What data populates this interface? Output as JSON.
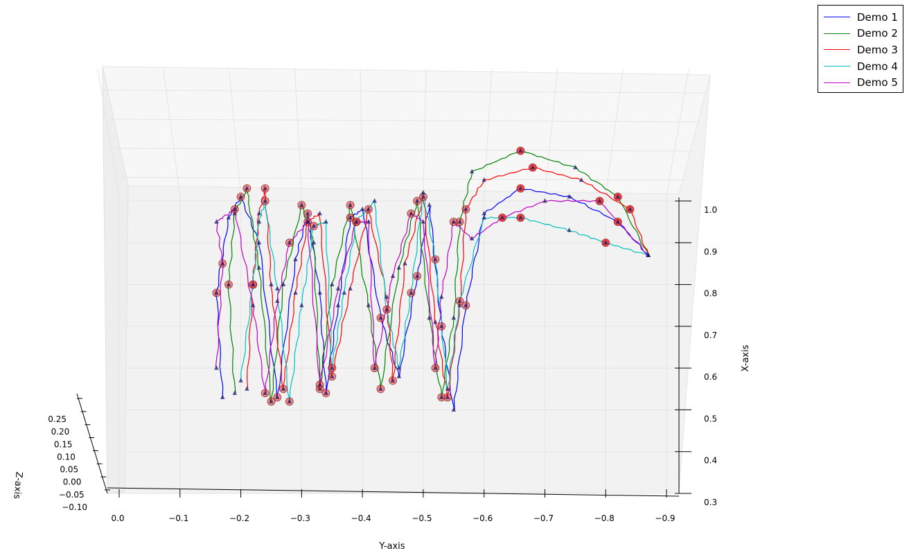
{
  "chart_data": {
    "type": "line",
    "projection": "3d",
    "xlabel": "Y-axis",
    "ylabel": "X-axis",
    "zlabel": "Z-axis",
    "y_axis_ticks": [
      "0.0",
      "−0.1",
      "−0.2",
      "−0.3",
      "−0.4",
      "−0.5",
      "−0.6",
      "−0.7",
      "−0.8",
      "−0.9"
    ],
    "x_axis_ticks": [
      "1.0",
      "0.9",
      "0.8",
      "0.7",
      "0.6",
      "0.5",
      "0.4",
      "0.3"
    ],
    "z_axis_ticks": [
      "0.25",
      "0.20",
      "0.15",
      "0.10",
      "0.05",
      "0.00",
      "−0.05",
      "−0.10"
    ],
    "y_range": [
      0.0,
      -0.9
    ],
    "x_range": [
      0.3,
      1.0
    ],
    "z_range": [
      -0.1,
      0.25
    ],
    "grid": true,
    "legend_position": "top-right",
    "colors": {
      "triangle_marker": "#1a1a6a",
      "circle_marker": "#ee3333",
      "pane": "#f2f2f2",
      "grid": "#e4e4e4"
    },
    "series": [
      {
        "name": "Demo 1",
        "color": "#0000ff",
        "points": [
          [
            -0.17,
            0.53
          ],
          [
            -0.16,
            0.78
          ],
          [
            -0.18,
            0.96
          ],
          [
            -0.2,
            1.01
          ],
          [
            -0.23,
            0.9
          ],
          [
            -0.26,
            0.53
          ],
          [
            -0.29,
            0.86
          ],
          [
            -0.31,
            0.97
          ],
          [
            -0.33,
            0.78
          ],
          [
            -0.34,
            0.54
          ],
          [
            -0.36,
            0.75
          ],
          [
            -0.38,
            0.96
          ],
          [
            -0.4,
            0.98
          ],
          [
            -0.43,
            0.72
          ],
          [
            -0.46,
            0.58
          ],
          [
            -0.49,
            0.82
          ],
          [
            -0.51,
            0.99
          ],
          [
            -0.53,
            0.7
          ],
          [
            -0.55,
            0.5
          ],
          [
            -0.57,
            0.75
          ],
          [
            -0.6,
            0.97
          ],
          [
            -0.66,
            1.03
          ],
          [
            -0.74,
            1.01
          ],
          [
            -0.82,
            0.95
          ],
          [
            -0.87,
            0.87
          ]
        ]
      },
      {
        "name": "Demo 2",
        "color": "#008000",
        "points": [
          [
            -0.19,
            0.54
          ],
          [
            -0.18,
            0.8
          ],
          [
            -0.19,
            0.97
          ],
          [
            -0.21,
            1.03
          ],
          [
            -0.23,
            0.84
          ],
          [
            -0.25,
            0.52
          ],
          [
            -0.27,
            0.8
          ],
          [
            -0.3,
            0.99
          ],
          [
            -0.32,
            0.9
          ],
          [
            -0.33,
            0.55
          ],
          [
            -0.35,
            0.8
          ],
          [
            -0.38,
            0.99
          ],
          [
            -0.41,
            0.75
          ],
          [
            -0.43,
            0.55
          ],
          [
            -0.46,
            0.84
          ],
          [
            -0.49,
            1.0
          ],
          [
            -0.51,
            0.72
          ],
          [
            -0.53,
            0.53
          ],
          [
            -0.55,
            0.72
          ],
          [
            -0.56,
            0.95
          ],
          [
            -0.58,
            1.07
          ],
          [
            -0.66,
            1.12
          ],
          [
            -0.75,
            1.08
          ],
          [
            -0.82,
            1.01
          ],
          [
            -0.87,
            0.87
          ]
        ]
      },
      {
        "name": "Demo 3",
        "color": "#ff0000",
        "points": [
          [
            -0.21,
            0.55
          ],
          [
            -0.22,
            0.8
          ],
          [
            -0.23,
            0.97
          ],
          [
            -0.24,
            1.03
          ],
          [
            -0.25,
            0.8
          ],
          [
            -0.27,
            0.55
          ],
          [
            -0.29,
            0.78
          ],
          [
            -0.31,
            0.95
          ],
          [
            -0.33,
            0.97
          ],
          [
            -0.35,
            0.58
          ],
          [
            -0.38,
            0.79
          ],
          [
            -0.41,
            0.98
          ],
          [
            -0.44,
            0.77
          ],
          [
            -0.45,
            0.57
          ],
          [
            -0.47,
            0.85
          ],
          [
            -0.5,
            1.01
          ],
          [
            -0.52,
            0.71
          ],
          [
            -0.54,
            0.53
          ],
          [
            -0.56,
            0.75
          ],
          [
            -0.57,
            0.98
          ],
          [
            -0.6,
            1.05
          ],
          [
            -0.68,
            1.08
          ],
          [
            -0.76,
            1.05
          ],
          [
            -0.84,
            0.98
          ],
          [
            -0.87,
            0.87
          ]
        ]
      },
      {
        "name": "Demo 4",
        "color": "#00bfbf",
        "points": [
          [
            -0.2,
            0.57
          ],
          [
            -0.22,
            0.8
          ],
          [
            -0.23,
            0.95
          ],
          [
            -0.24,
            1.0
          ],
          [
            -0.26,
            0.79
          ],
          [
            -0.28,
            0.52
          ],
          [
            -0.3,
            0.75
          ],
          [
            -0.32,
            0.94
          ],
          [
            -0.34,
            0.95
          ],
          [
            -0.35,
            0.6
          ],
          [
            -0.37,
            0.78
          ],
          [
            -0.39,
            0.95
          ],
          [
            -0.42,
            1.0
          ],
          [
            -0.44,
            0.74
          ],
          [
            -0.46,
            0.6
          ],
          [
            -0.48,
            0.78
          ],
          [
            -0.5,
            1.02
          ],
          [
            -0.52,
            0.86
          ],
          [
            -0.54,
            0.55
          ],
          [
            -0.56,
            0.76
          ],
          [
            -0.6,
            0.96
          ],
          [
            -0.66,
            0.96
          ],
          [
            -0.74,
            0.93
          ],
          [
            -0.8,
            0.9
          ],
          [
            -0.87,
            0.87
          ]
        ]
      },
      {
        "name": "Demo 5",
        "color": "#bf00bf",
        "points": [
          [
            -0.16,
            0.6
          ],
          [
            -0.17,
            0.85
          ],
          [
            -0.16,
            0.95
          ],
          [
            -0.19,
            0.98
          ],
          [
            -0.22,
            0.75
          ],
          [
            -0.24,
            0.54
          ],
          [
            -0.26,
            0.76
          ],
          [
            -0.28,
            0.9
          ],
          [
            -0.31,
            0.95
          ],
          [
            -0.33,
            0.56
          ],
          [
            -0.36,
            0.79
          ],
          [
            -0.39,
            0.95
          ],
          [
            -0.41,
            0.95
          ],
          [
            -0.42,
            0.6
          ],
          [
            -0.45,
            0.82
          ],
          [
            -0.48,
            0.97
          ],
          [
            -0.5,
            0.95
          ],
          [
            -0.52,
            0.6
          ],
          [
            -0.53,
            0.77
          ],
          [
            -0.55,
            0.95
          ],
          [
            -0.58,
            0.91
          ],
          [
            -0.63,
            0.96
          ],
          [
            -0.7,
            1.0
          ],
          [
            -0.79,
            1.0
          ],
          [
            -0.87,
            0.87
          ]
        ]
      }
    ]
  }
}
